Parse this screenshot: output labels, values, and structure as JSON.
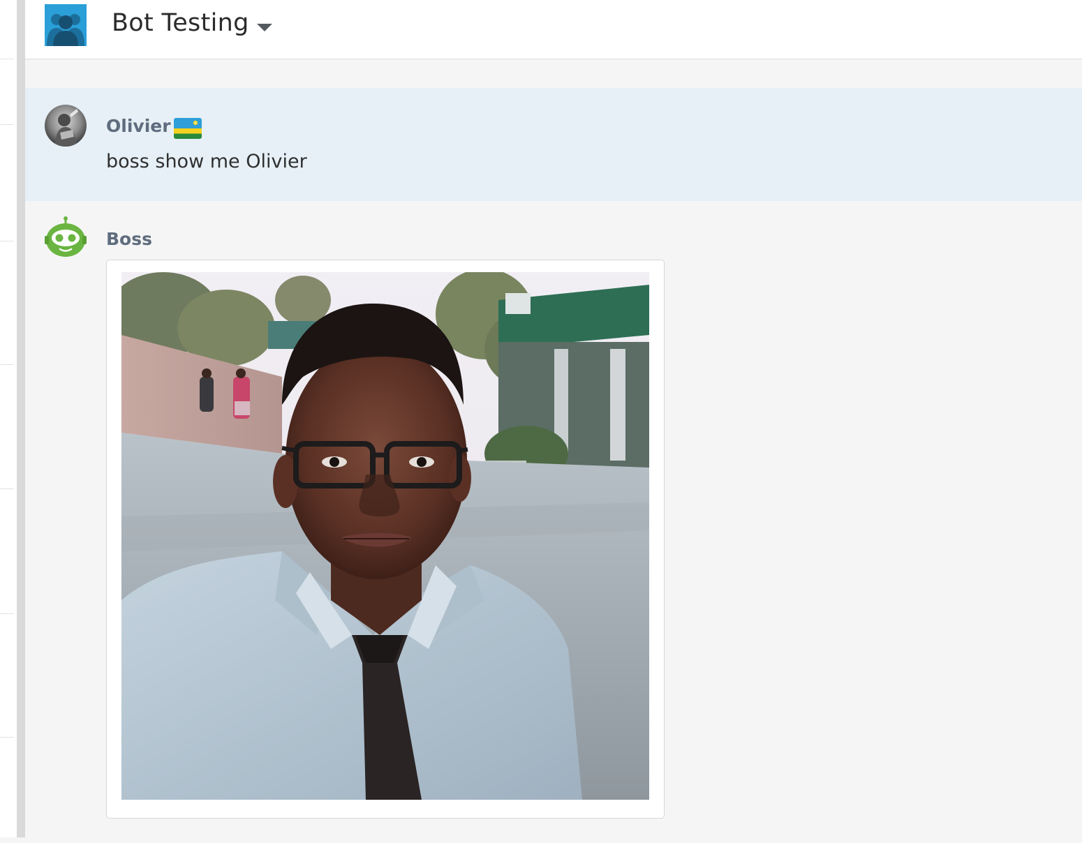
{
  "header": {
    "room_title": "Bot Testing",
    "room_icon": "group-users-icon",
    "dropdown_icon": "caret-down-icon"
  },
  "messages": [
    {
      "author": "Olivier",
      "author_flag": "rwanda-flag-icon",
      "text": "boss show me Olivier",
      "highlighted": true
    },
    {
      "author": "Boss",
      "avatar": "bot-avatar-icon",
      "attachment": "photo-image"
    }
  ],
  "colors": {
    "room_icon_bg": "#2a9fd8",
    "highlight_bg": "#e6f0f6",
    "author_name": "#5f6c7e",
    "bot_green": "#6ab541"
  }
}
